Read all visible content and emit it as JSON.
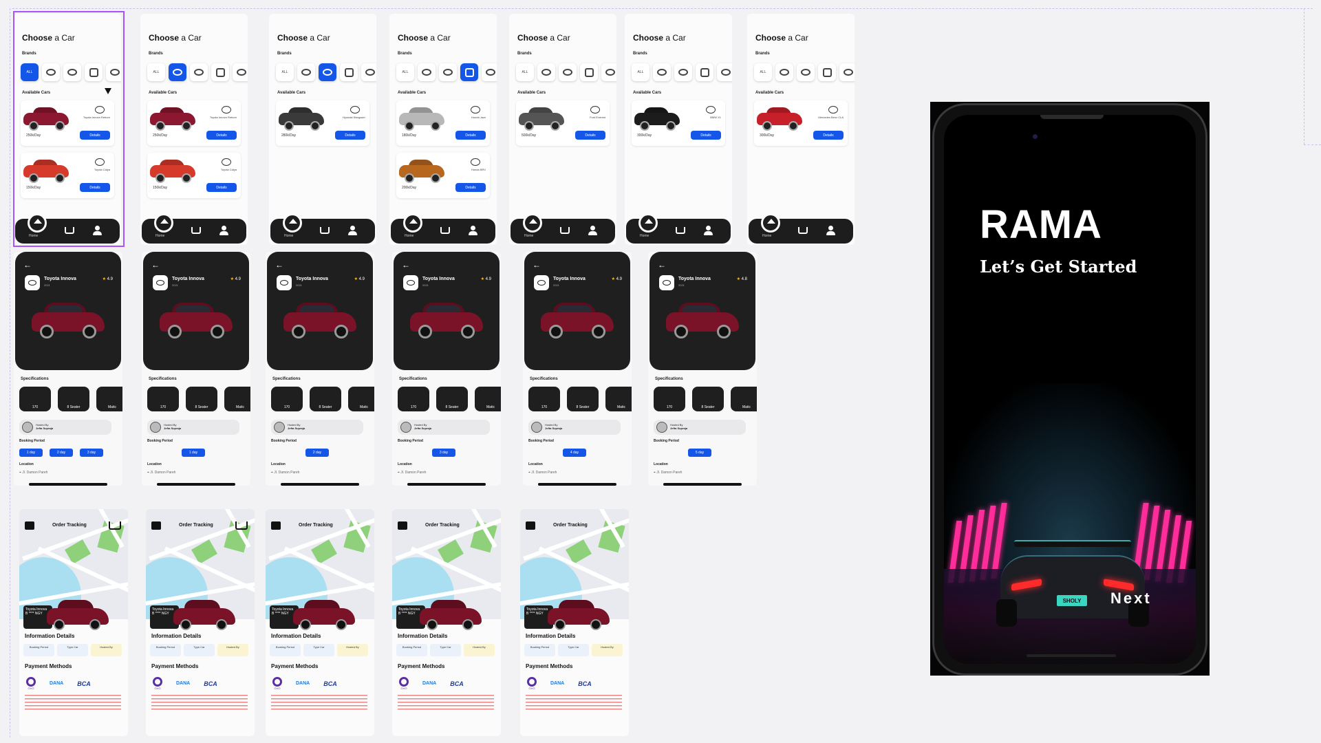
{
  "choose": {
    "title_bold": "Choose",
    "title_rest": " a Car",
    "brands_label": "Brands",
    "all_label": "ALL",
    "available_label": "Available Cars",
    "details_label": "Details",
    "nav_home": "Home",
    "frames": [
      {
        "cards": [
          {
            "name": "Toyota Innova Reborn",
            "price": "250k/Day",
            "color": "#8b1730"
          },
          {
            "name": "Toyota Calya",
            "price": "150k/Day",
            "color": "#d63a2a"
          }
        ]
      },
      {
        "cards": [
          {
            "name": "Toyota Innova Reborn",
            "price": "250k/Day",
            "color": "#8b1730"
          },
          {
            "name": "Toyota Calya",
            "price": "150k/Day",
            "color": "#d63a2a"
          }
        ]
      },
      {
        "cards": [
          {
            "name": "Hyundai Stargazer",
            "price": "280k/Day",
            "color": "#3a3a3a"
          }
        ]
      },
      {
        "cards": [
          {
            "name": "Honda Jazz",
            "price": "180k/Day",
            "color": "#b8b8b8"
          },
          {
            "name": "Honda BRV",
            "price": "200k/Day",
            "color": "#b8671f"
          }
        ]
      },
      {
        "cards": [
          {
            "name": "Ford Everest",
            "price": "500k/Day",
            "color": "#555555"
          }
        ]
      },
      {
        "cards": [
          {
            "name": "BMW X1",
            "price": "300k/Day",
            "color": "#1c1c1c"
          }
        ]
      },
      {
        "cards": [
          {
            "name": "Mercedes Benz CLA",
            "price": "300k/Day",
            "color": "#c8202a"
          }
        ]
      }
    ]
  },
  "detail": {
    "car_name": "Toyota Innova",
    "year": "2021",
    "frames": [
      {
        "rating": "4.9",
        "days": [
          "1 day",
          "2 day",
          "3 day"
        ]
      },
      {
        "rating": "4.9",
        "days": [
          "1 day"
        ]
      },
      {
        "rating": "4.9",
        "days": [
          "2 day"
        ]
      },
      {
        "rating": "4.9",
        "days": [
          "3 day"
        ]
      },
      {
        "rating": "4.9",
        "days": [
          "4 day"
        ]
      },
      {
        "rating": "4.8",
        "days": [
          "5 day"
        ]
      }
    ],
    "specs_label": "Specifications",
    "spec_speed": "170",
    "spec_seats": "8 Seater",
    "spec_trans": "Matic",
    "hosted_by": "Hosted By",
    "host_name": "Jefta Supraja",
    "booking_label": "Booking Period",
    "location_label": "Location",
    "address": "Jl. Damon Pareh"
  },
  "tracking": {
    "title": "Order Tracking",
    "car_name": "Toyota Innova",
    "plate": "B **** NGY",
    "info_label": "Information Details",
    "booking_period": "Booking Period",
    "type_car": "Type Car",
    "hosted_by": "Hosted By",
    "payment_label": "Payment Methods",
    "pay_ovo": "OVO",
    "pay_dana": "DANA",
    "pay_bca": "BCA"
  },
  "phone": {
    "title": "RAMA",
    "tagline": "Let’s Get Started",
    "plate": "SHOLY",
    "next_label": "Next"
  },
  "colors": {
    "accent": "#1456e8",
    "selection": "#a855f7",
    "neon": "#ff2d9a"
  }
}
